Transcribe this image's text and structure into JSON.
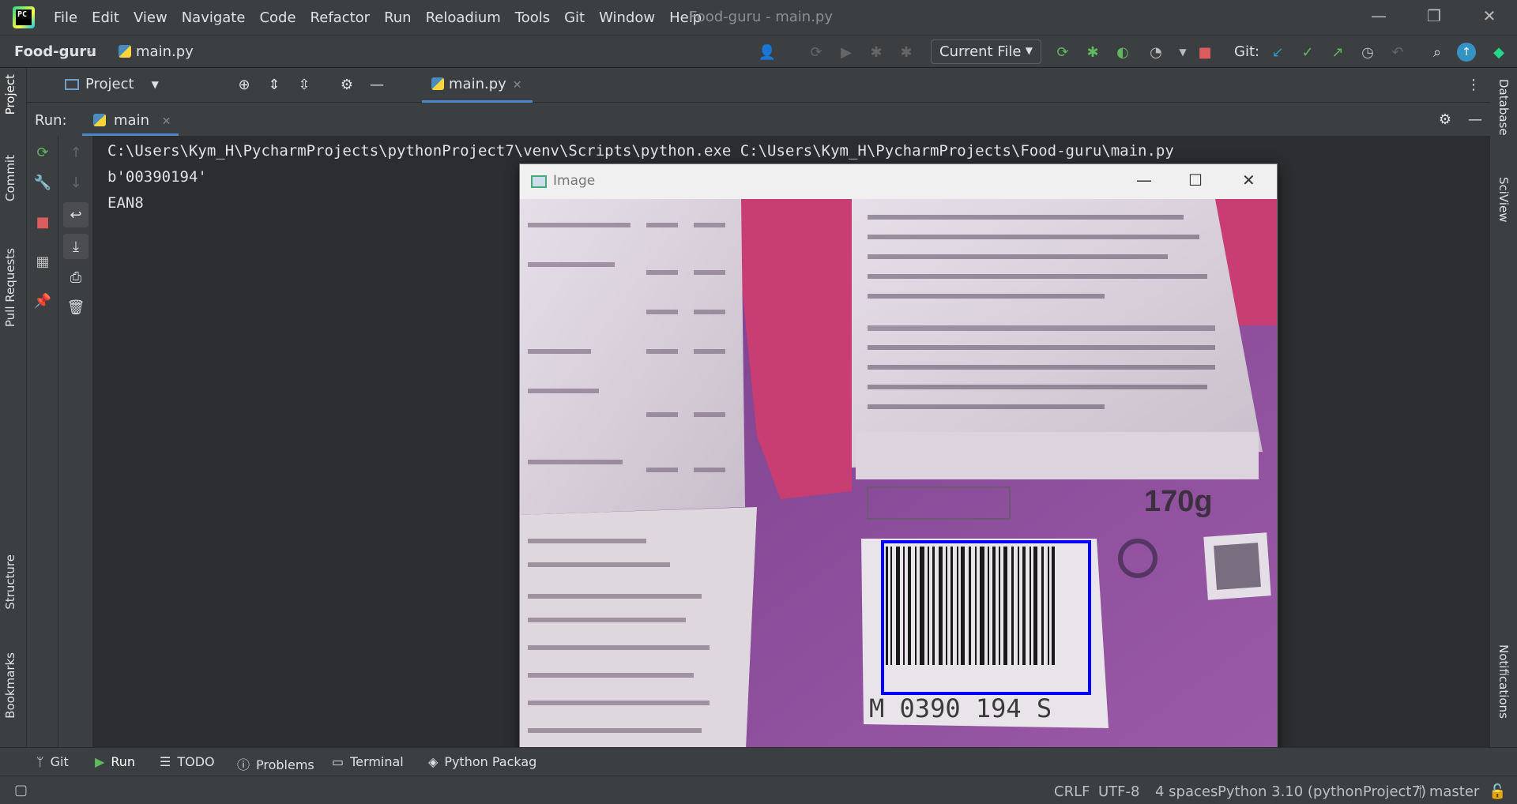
{
  "menu": [
    "File",
    "Edit",
    "View",
    "Navigate",
    "Code",
    "Refactor",
    "Run",
    "Reloadium",
    "Tools",
    "Git",
    "Window",
    "Help"
  ],
  "window_title": "Food-guru - main.py",
  "breadcrumb": {
    "project": "Food-guru",
    "file": "main.py"
  },
  "run_config": "Current File",
  "git_label": "Git:",
  "left_tabs": {
    "project": "Project",
    "commit": "Commit",
    "pull_requests": "Pull Requests",
    "structure": "Structure",
    "bookmarks": "Bookmarks"
  },
  "right_tabs": {
    "database": "Database",
    "sciview": "SciView",
    "notifications": "Notifications"
  },
  "tool_window": {
    "project_label": "Project",
    "editor_tab": "main.py"
  },
  "run_panel": {
    "label": "Run:",
    "tab": "main"
  },
  "console": [
    "C:\\Users\\Kym_H\\PycharmProjects\\pythonProject7\\venv\\Scripts\\python.exe C:\\Users\\Kym_H\\PycharmProjects\\Food-guru\\main.py",
    "b'00390194'",
    "EAN8"
  ],
  "image_window": {
    "title": "Image",
    "barcode_text": "M 0390 194 S",
    "weight": "170g"
  },
  "bottom_tabs": [
    "Git",
    "Run",
    "TODO",
    "Problems",
    "Terminal",
    "Python Packag"
  ],
  "status": {
    "line_sep": "CRLF",
    "encoding": "UTF-8",
    "indent": "4 spaces",
    "interpreter": "Python 3.10 (pythonProject7)",
    "branch": "master"
  },
  "colors": {
    "bg": "#2b2d30",
    "panel": "#3c3f41",
    "accent": "#4a88c7",
    "detect_box": "#0000ff"
  }
}
